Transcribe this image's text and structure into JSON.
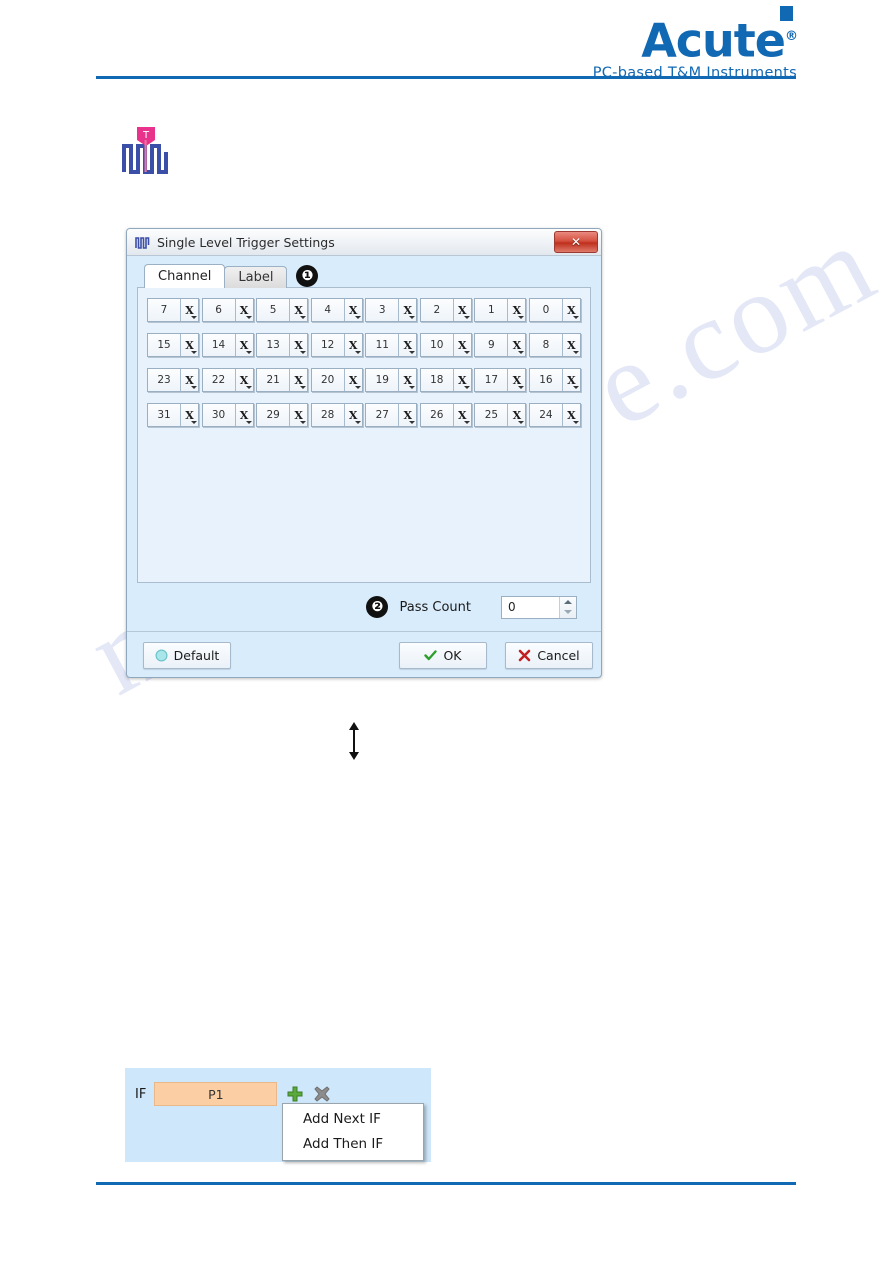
{
  "brand": {
    "name": "Acute",
    "registered": "®",
    "tagline": "PC-based T&M Instruments",
    "accent_color": "#1168b3"
  },
  "trigger_icon": {
    "name": "single-level-trigger-icon",
    "flag_letter": "T",
    "waveform_color": "#3b4ea8",
    "flag_color": "#e8328c"
  },
  "dialog": {
    "title": "Single Level Trigger Settings",
    "close_label": "✕",
    "tabs": [
      {
        "label": "Channel",
        "active": true
      },
      {
        "label": "Label",
        "active": false
      }
    ],
    "markers": {
      "tab_marker": "❶",
      "pass_marker": "❷"
    },
    "channel_rows": [
      [
        {
          "num": "7",
          "state": "X"
        },
        {
          "num": "6",
          "state": "X"
        },
        {
          "num": "5",
          "state": "X"
        },
        {
          "num": "4",
          "state": "X"
        },
        {
          "num": "3",
          "state": "X"
        },
        {
          "num": "2",
          "state": "X"
        },
        {
          "num": "1",
          "state": "X"
        },
        {
          "num": "0",
          "state": "X"
        }
      ],
      [
        {
          "num": "15",
          "state": "X"
        },
        {
          "num": "14",
          "state": "X"
        },
        {
          "num": "13",
          "state": "X"
        },
        {
          "num": "12",
          "state": "X"
        },
        {
          "num": "11",
          "state": "X"
        },
        {
          "num": "10",
          "state": "X"
        },
        {
          "num": "9",
          "state": "X"
        },
        {
          "num": "8",
          "state": "X"
        }
      ],
      [
        {
          "num": "23",
          "state": "X"
        },
        {
          "num": "22",
          "state": "X"
        },
        {
          "num": "21",
          "state": "X"
        },
        {
          "num": "20",
          "state": "X"
        },
        {
          "num": "19",
          "state": "X"
        },
        {
          "num": "18",
          "state": "X"
        },
        {
          "num": "17",
          "state": "X"
        },
        {
          "num": "16",
          "state": "X"
        }
      ],
      [
        {
          "num": "31",
          "state": "X"
        },
        {
          "num": "30",
          "state": "X"
        },
        {
          "num": "29",
          "state": "X"
        },
        {
          "num": "28",
          "state": "X"
        },
        {
          "num": "27",
          "state": "X"
        },
        {
          "num": "26",
          "state": "X"
        },
        {
          "num": "25",
          "state": "X"
        },
        {
          "num": "24",
          "state": "X"
        }
      ]
    ],
    "pass_count": {
      "label": "Pass Count",
      "value": "0"
    },
    "footer": {
      "default_label": "Default",
      "ok_label": "OK",
      "cancel_label": "Cancel"
    }
  },
  "if_panel": {
    "if_label": "IF",
    "pattern_label": "P1",
    "menu_items": [
      {
        "label": "Add Next IF"
      },
      {
        "label": "Add Then IF"
      }
    ]
  },
  "watermark": {
    "text": "manualshive.com"
  }
}
